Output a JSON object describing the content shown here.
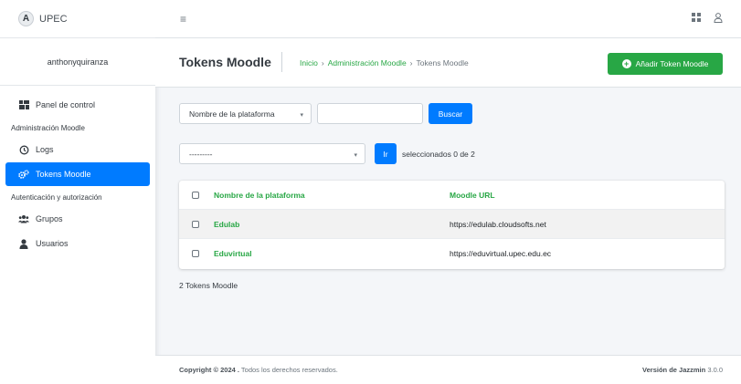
{
  "brand": {
    "logo": "A",
    "name": "UPEC"
  },
  "user": {
    "name": "anthonyquiranza"
  },
  "sidebar": {
    "dashboard": "Panel de control",
    "section1": "Administración Moodle",
    "logs": "Logs",
    "tokens": "Tokens Moodle",
    "section2": "Autenticación y autorización",
    "groups": "Grupos",
    "users": "Usuarios"
  },
  "header": {
    "title": "Tokens Moodle",
    "breadcrumb": [
      "Inicio",
      "Administración Moodle",
      "Tokens Moodle"
    ],
    "breadcrumb_sep": "›",
    "add_button": "Añadir Token Moodle"
  },
  "search": {
    "field_select": "Nombre de la plataforma",
    "input_value": "",
    "button": "Buscar"
  },
  "actions": {
    "select": "---------",
    "go_button": "Ir",
    "selected_text": "seleccionados 0 de 2"
  },
  "table": {
    "columns": [
      "Nombre de la plataforma",
      "Moodle URL"
    ],
    "rows": [
      {
        "name": "Edulab",
        "url": "https://edulab.cloudsofts.net"
      },
      {
        "name": "Eduvirtual",
        "url": "https://eduvirtual.upec.edu.ec"
      }
    ],
    "count_text": "2 Tokens Moodle"
  },
  "footer": {
    "copyright_strong": "Copyright © 2024 .",
    "copyright_rest": "Todos los derechos reservados.",
    "version_label": "Versión de Jazzmin",
    "version_number": "3.0.0"
  },
  "colors": {
    "primary": "#007bff",
    "success": "#28a745"
  }
}
